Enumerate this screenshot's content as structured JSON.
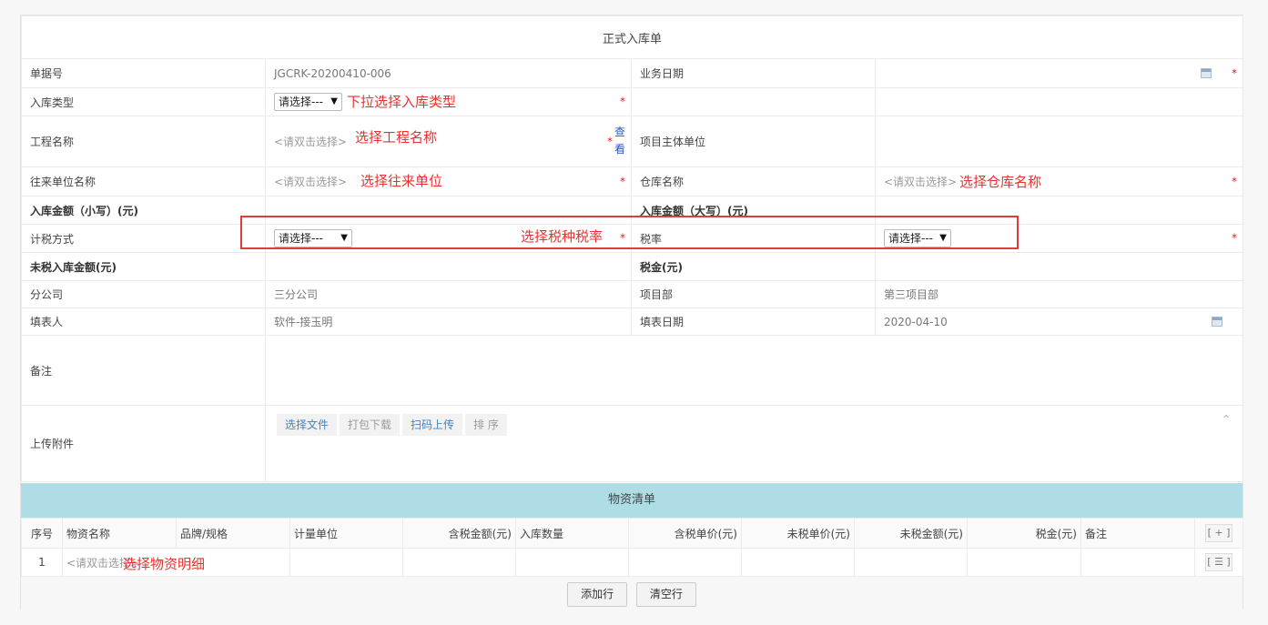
{
  "form": {
    "title": "正式入库单",
    "doc_no_label": "单据号",
    "doc_no_value": "JGCRK-20200410-006",
    "biz_date_label": "业务日期",
    "in_type_label": "入库类型",
    "in_type_select": "请选择---",
    "project_label": "工程名称",
    "project_ph": "<请双击选择>",
    "look_label": "查看",
    "owner_label": "项目主体单位",
    "partner_label": "往来单位名称",
    "partner_ph": "<请双击选择>",
    "warehouse_label": "仓库名称",
    "warehouse_ph": "<请双击选择>",
    "amount_small_label": "入库金额（小写）(元)",
    "amount_big_label": "入库金额（大写）(元)",
    "tax_method_label": "计税方式",
    "tax_method_select": "请选择---",
    "tax_rate_label": "税率",
    "tax_rate_select": "请选择---",
    "untaxed_label": "未税入库金额(元)",
    "tax_label": "税金(元)",
    "branch_label": "分公司",
    "branch_value": "三分公司",
    "dept_label": "项目部",
    "dept_value": "第三项目部",
    "filler_label": "填表人",
    "filler_value": "软件-接玉明",
    "fill_date_label": "填表日期",
    "fill_date_value": "2020-04-10",
    "remark_label": "备注",
    "upload_label": "上传附件",
    "upload_buttons": [
      "选择文件",
      "打包下载",
      "扫码上传",
      "排 序"
    ],
    "required_mark": "*",
    "collapse_glyph": "⌃"
  },
  "annotations": {
    "in_type": "下拉选择入库类型",
    "project": "选择工程名称",
    "partner": "选择往来单位",
    "warehouse": "选择仓库名称",
    "tax": "选择税种税率",
    "material": "选择物资明细"
  },
  "materials": {
    "title": "物资清单",
    "columns": [
      "序号",
      "物资名称",
      "品牌/规格",
      "计量单位",
      "含税金额(元)",
      "入库数量",
      "含税单价(元)",
      "未税单价(元)",
      "未税金额(元)",
      "税金(元)",
      "备注"
    ],
    "add_icon": "[ + ]",
    "rows": [
      {
        "no": "1",
        "name_ph": "<请双击选择>",
        "row_icon": "[ ☰ ]"
      }
    ]
  },
  "footer": {
    "add_row": "添加行",
    "clear_rows": "清空行"
  }
}
